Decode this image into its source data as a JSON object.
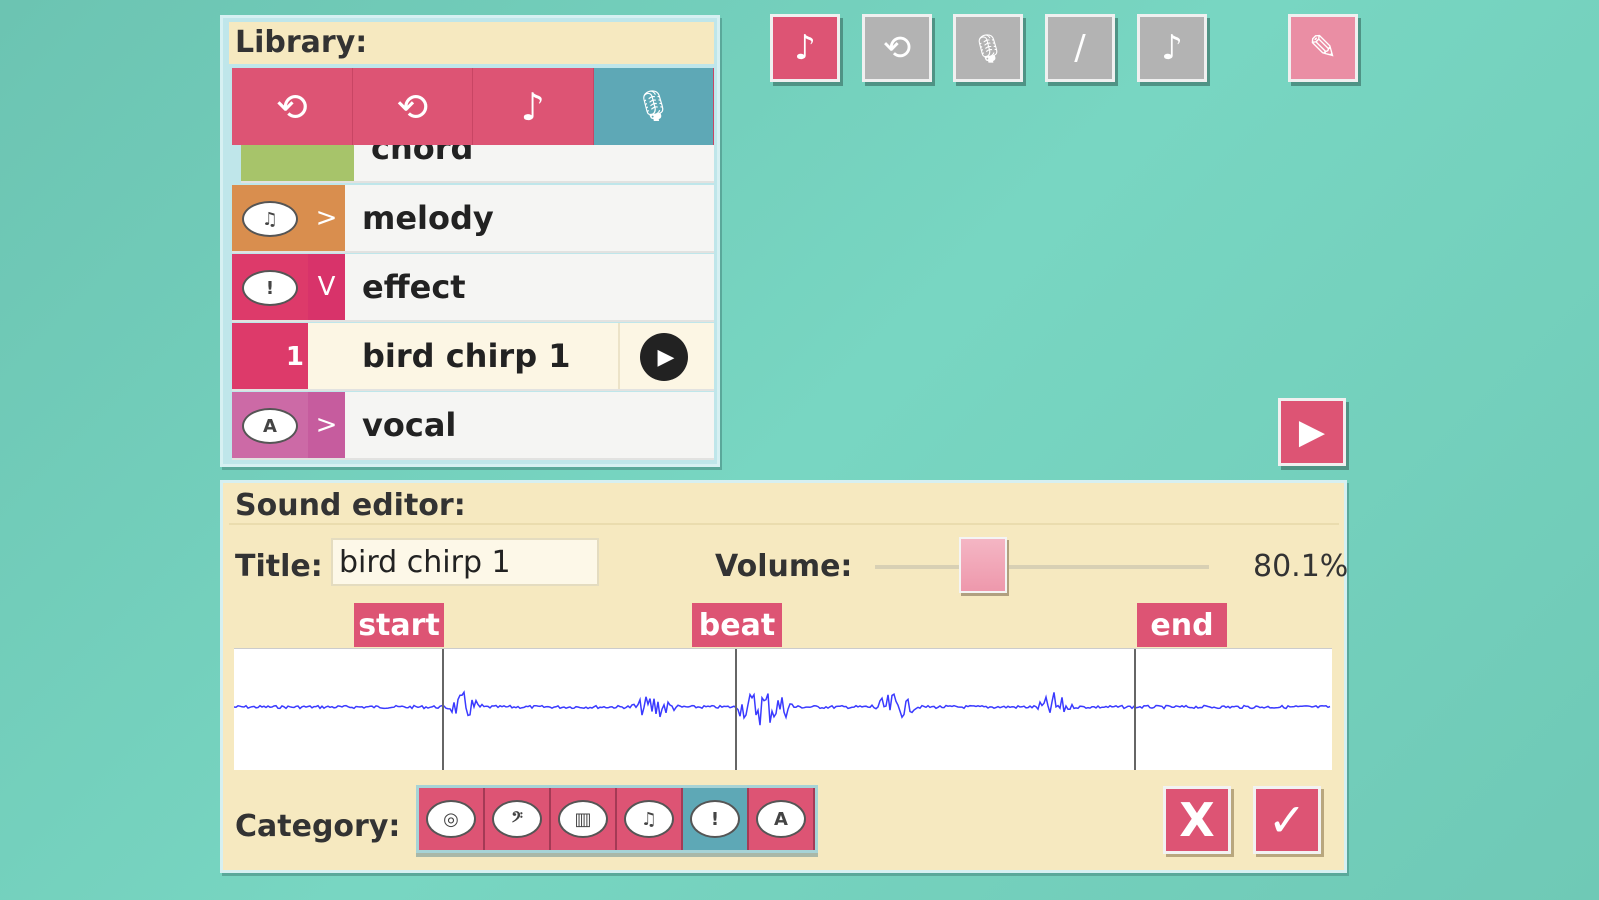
{
  "toolbar": {
    "buttons": [
      {
        "name": "sheet-music-icon",
        "glyph": "♪",
        "active": true
      },
      {
        "name": "add-loop-icon",
        "glyph": "⟲",
        "active": false
      },
      {
        "name": "microphone-icon",
        "glyph": "🎙",
        "active": false
      },
      {
        "name": "maraca-icon",
        "glyph": "/",
        "active": false
      },
      {
        "name": "note-file-icon",
        "glyph": "♪",
        "active": false
      },
      {
        "name": "edit-note-icon",
        "glyph": "✎",
        "active": true
      }
    ]
  },
  "library": {
    "title": "Library:",
    "tabs": [
      {
        "icon": "loop-plus-icon",
        "glyph": "⟲"
      },
      {
        "icon": "loop-icon",
        "glyph": "⟲"
      },
      {
        "icon": "note-icon",
        "glyph": "♪"
      },
      {
        "icon": "microphone-icon",
        "glyph": "🎙"
      }
    ],
    "rows": [
      {
        "label": "chord",
        "arrow": "",
        "glyph": "",
        "color": "#a7c46a"
      },
      {
        "label": "melody",
        "arrow": ">",
        "glyph": "♫",
        "color": "#d98e4e"
      },
      {
        "label": "effect",
        "arrow": "V",
        "glyph": "!",
        "color": "#dd3a6a"
      },
      {
        "label": "vocal",
        "arrow": ">",
        "glyph": "A",
        "color": "#cc6aa6"
      }
    ],
    "selected": {
      "number": "1",
      "label": "bird chirp 1"
    }
  },
  "editor": {
    "title": "Sound editor:",
    "title_label": "Title:",
    "title_value": "bird chirp 1",
    "volume_label": "Volume:",
    "volume_percent": 80.1,
    "volume_text": "80.1%",
    "markers": {
      "start": "start",
      "beat": "beat",
      "end": "end"
    },
    "category_label": "Category:",
    "categories": [
      {
        "name": "drum-icon",
        "glyph": "◎"
      },
      {
        "name": "bass-clef-icon",
        "glyph": "𝄢"
      },
      {
        "name": "piano-icon",
        "glyph": "▥"
      },
      {
        "name": "melody-icon",
        "glyph": "♫"
      },
      {
        "name": "effect-icon",
        "glyph": "!"
      },
      {
        "name": "vocal-icon",
        "glyph": "A"
      }
    ],
    "cancel": "X",
    "confirm": "✓"
  },
  "colors": {
    "accent": "#dd5474",
    "selected": "#5ea8b6",
    "wave": "#3a3aff"
  }
}
